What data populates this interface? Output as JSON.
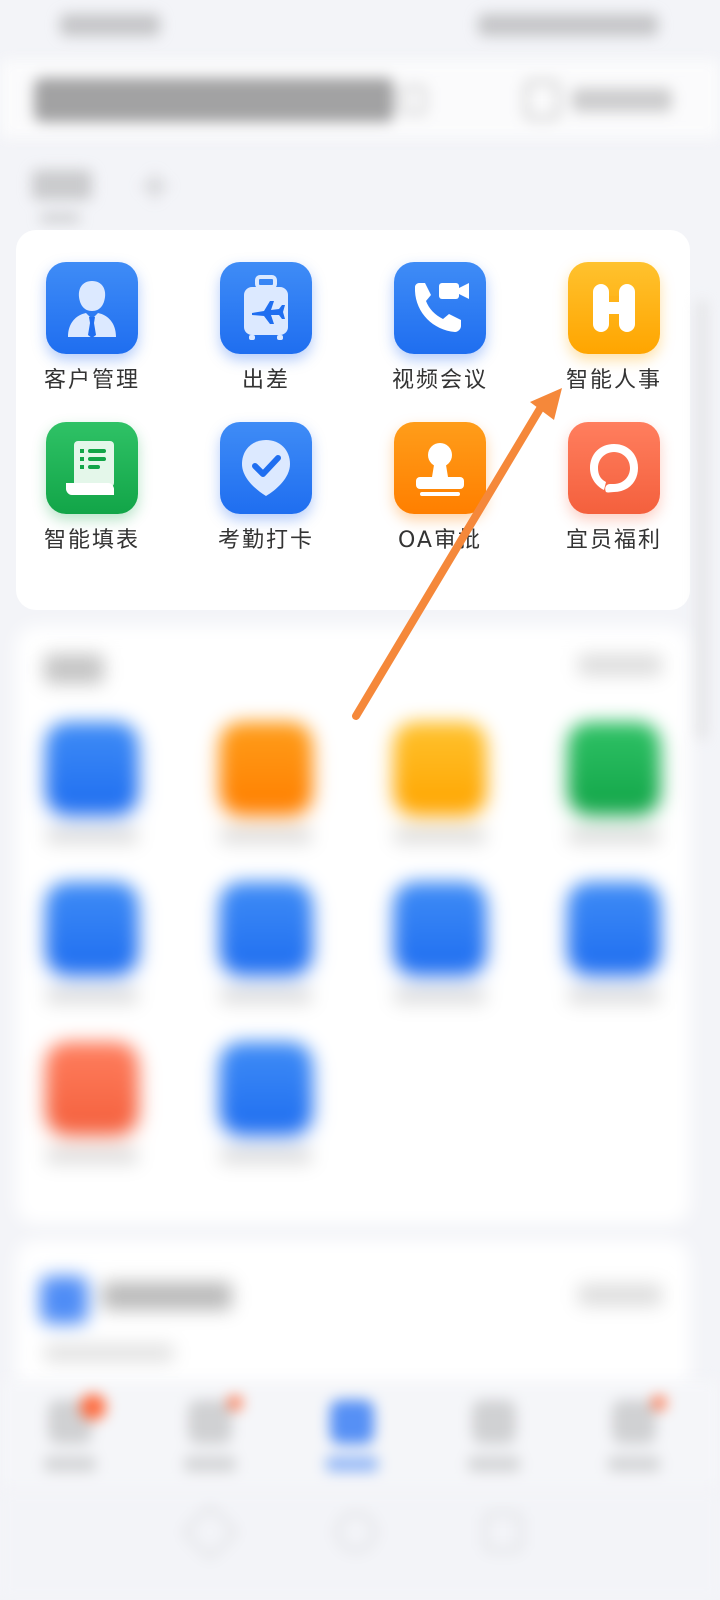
{
  "apps": [
    {
      "label": "客户管理",
      "icon": "customer-icon",
      "color": "#1f6ef0"
    },
    {
      "label": "出差",
      "icon": "luggage-icon",
      "color": "#1f6ef0"
    },
    {
      "label": "视频会议",
      "icon": "video-call-icon",
      "color": "#1f6ef0"
    },
    {
      "label": "智能人事",
      "icon": "h-logo-icon",
      "color": "#ffa500"
    },
    {
      "label": "智能填表",
      "icon": "form-scroll-icon",
      "color": "#12a548"
    },
    {
      "label": "考勤打卡",
      "icon": "location-check-icon",
      "color": "#1f6ef0"
    },
    {
      "label": "OA审批",
      "icon": "stamp-icon",
      "color": "#ff7f00"
    },
    {
      "label": "宜员福利",
      "icon": "welfare-icon",
      "color": "#f4603d"
    }
  ],
  "colors": {
    "annotation_arrow": "#f5883a",
    "active_nav": "#3a7ef5",
    "badge": "#ff6a3d"
  }
}
